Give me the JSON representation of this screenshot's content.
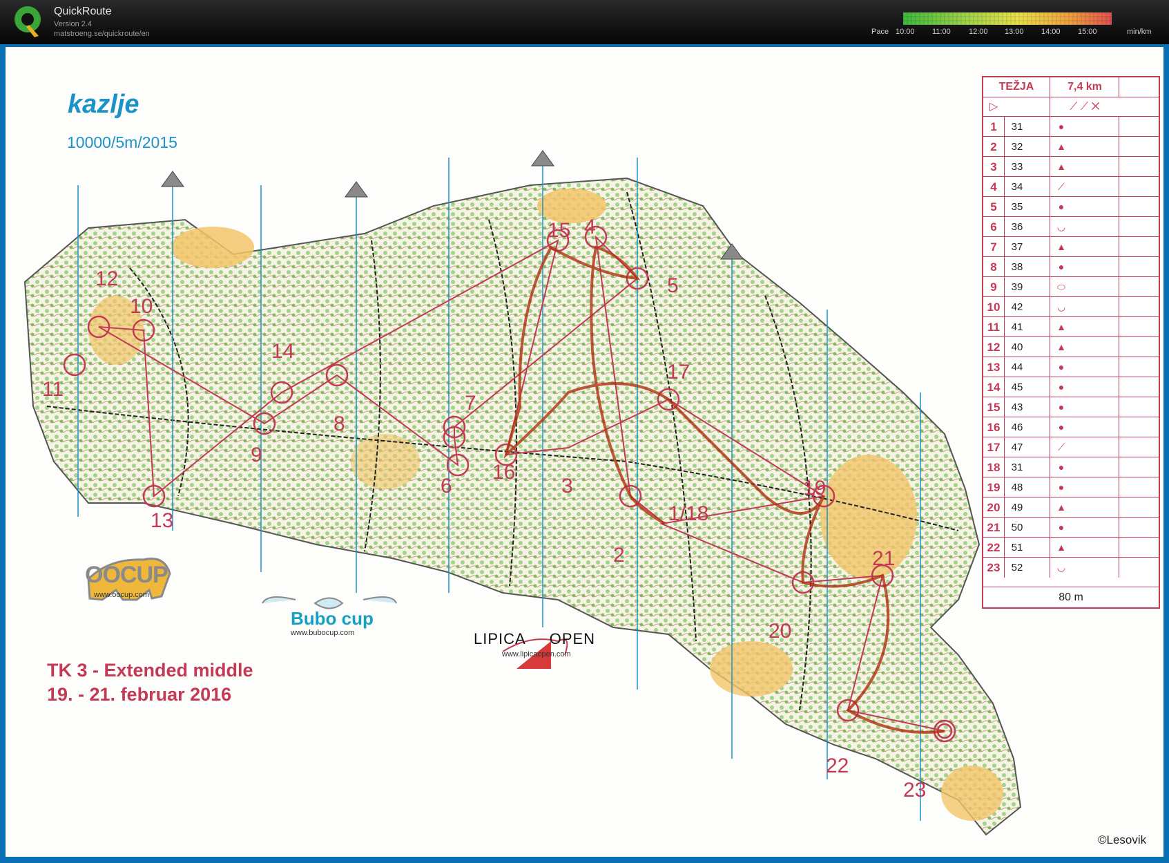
{
  "app": {
    "name": "QuickRoute",
    "version": "Version 2.4",
    "url": "matstroeng.se/quickroute/en"
  },
  "pace_legend": {
    "label": "Pace",
    "ticks": [
      "10:00",
      "11:00",
      "12:00",
      "13:00",
      "14:00",
      "15:00"
    ],
    "unit": "min/km",
    "colors": [
      "#3fb83f",
      "#9fd24a",
      "#e8e04a",
      "#f0a040",
      "#e05050"
    ]
  },
  "map": {
    "title": "kazlje",
    "scale_info": "10000/5m/2015",
    "event_title": "TK 3 - Extended middle",
    "event_dates": "19. - 21. februar 2016",
    "copyright": "©Lesovik",
    "sponsors": {
      "oocup": "OOCUP",
      "oocup_url": "www.oocup.com",
      "bubo": "Bubo cup",
      "bubo_url": "www.bubocup.com",
      "lipica_left": "LIPICA",
      "lipica_right": "OPEN",
      "lipica_url": "www.lipicaopen.com"
    },
    "control_labels": [
      "1/18",
      "2",
      "3",
      "4",
      "5",
      "6",
      "7",
      "8",
      "9",
      "10",
      "11",
      "12",
      "13",
      "14",
      "15",
      "16",
      "17",
      "19",
      "20",
      "21",
      "22",
      "23"
    ],
    "colors": {
      "overprint": "#c43a55",
      "magnetic_north": "#1a93c8",
      "open_land": "#f3c46a",
      "green": "#8fcf7a"
    }
  },
  "control_description": {
    "course": "TEŽJA",
    "length": "7,4 km",
    "finish_distance": "80 m",
    "rows": [
      {
        "n": "1",
        "code": "31"
      },
      {
        "n": "2",
        "code": "32"
      },
      {
        "n": "3",
        "code": "33"
      },
      {
        "n": "4",
        "code": "34"
      },
      {
        "n": "5",
        "code": "35"
      },
      {
        "n": "6",
        "code": "36"
      },
      {
        "n": "7",
        "code": "37"
      },
      {
        "n": "8",
        "code": "38"
      },
      {
        "n": "9",
        "code": "39"
      },
      {
        "n": "10",
        "code": "42"
      },
      {
        "n": "11",
        "code": "41"
      },
      {
        "n": "12",
        "code": "40"
      },
      {
        "n": "13",
        "code": "44"
      },
      {
        "n": "14",
        "code": "45"
      },
      {
        "n": "15",
        "code": "43"
      },
      {
        "n": "16",
        "code": "46"
      },
      {
        "n": "17",
        "code": "47"
      },
      {
        "n": "18",
        "code": "31"
      },
      {
        "n": "19",
        "code": "48"
      },
      {
        "n": "20",
        "code": "49"
      },
      {
        "n": "21",
        "code": "50"
      },
      {
        "n": "22",
        "code": "51"
      },
      {
        "n": "23",
        "code": "52"
      }
    ],
    "symbols": [
      "dot",
      "triangle",
      "triangle",
      "slash",
      "dot",
      "cup",
      "triangle",
      "dot",
      "ellipse",
      "cup",
      "triangle",
      "triangle",
      "dot",
      "dot",
      "dot",
      "dot",
      "slash",
      "dot",
      "dot",
      "triangle",
      "dot",
      "triangle",
      "cup"
    ]
  }
}
